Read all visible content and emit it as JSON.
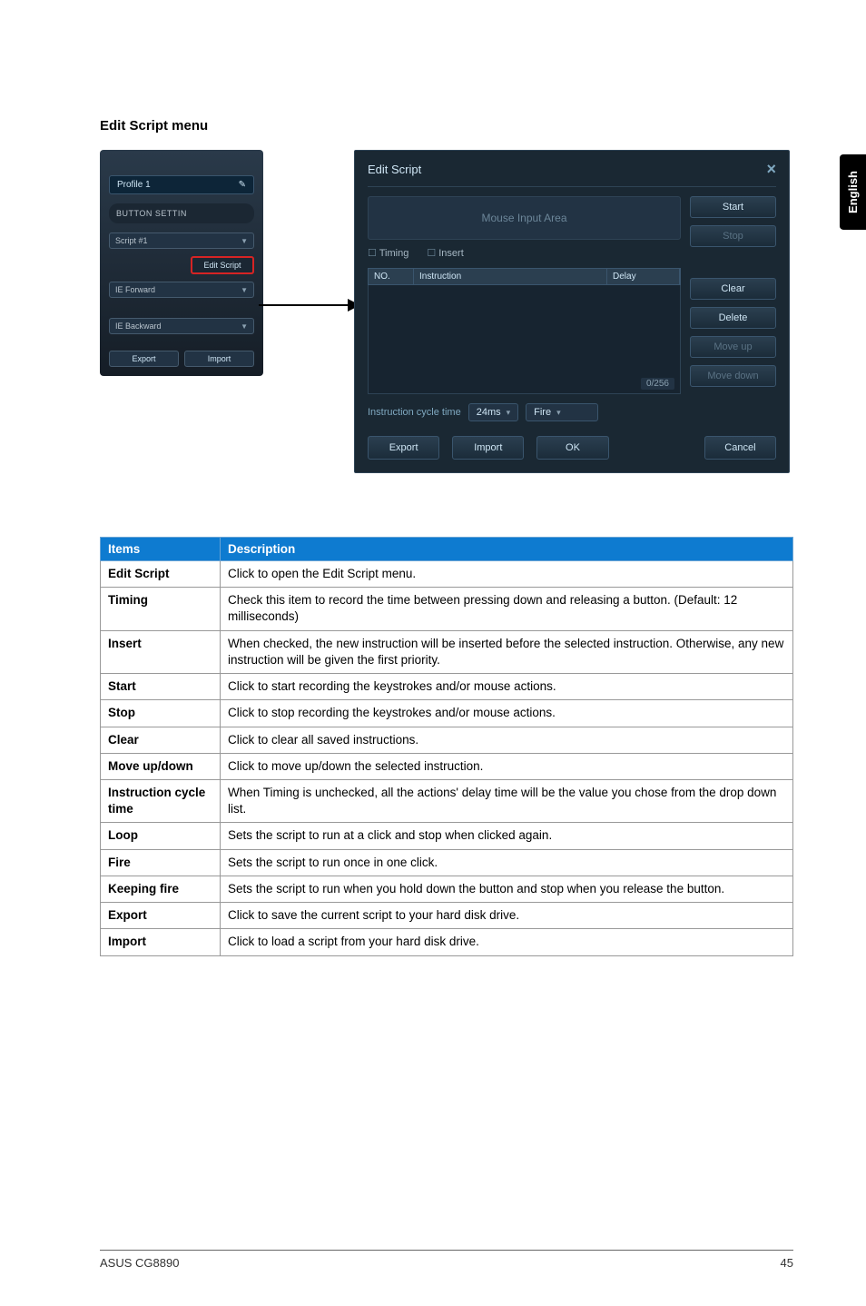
{
  "side_tab": "English",
  "section_title": "Edit Script menu",
  "left_panel": {
    "profile": "Profile 1",
    "button_settin": "BUTTON SETTIN",
    "script_dd": "Script #1",
    "edit_script_btn": "Edit Script",
    "ie_forward": "IE Forward",
    "ie_backward": "IE Backward",
    "export": "Export",
    "import": "Import"
  },
  "dialog": {
    "title": "Edit Script",
    "close": "×",
    "mouse_input": "Mouse Input Area",
    "timing": "Timing",
    "insert": "Insert",
    "col_no": "NO.",
    "col_inst": "Instruction",
    "col_delay": "Delay",
    "counter": "0/256",
    "cycle_label": "Instruction cycle time",
    "cycle_value": "24ms",
    "fire_dd": "Fire",
    "buttons": {
      "start": "Start",
      "stop": "Stop",
      "clear": "Clear",
      "delete": "Delete",
      "move_up": "Move up",
      "move_down": "Move down",
      "export": "Export",
      "import": "Import",
      "ok": "OK",
      "cancel": "Cancel"
    }
  },
  "table": {
    "headers": {
      "items": "Items",
      "desc": "Description"
    },
    "rows": [
      {
        "item": "Edit Script",
        "desc": "Click to open the Edit Script menu."
      },
      {
        "item": "Timing",
        "desc": "Check this item to record the time between pressing down and releasing a button. (Default: 12 milliseconds)"
      },
      {
        "item": "Insert",
        "desc": "When checked, the new instruction will be inserted before the selected instruction. Otherwise, any new instruction will be given the first priority."
      },
      {
        "item": "Start",
        "desc": "Click to start recording the keystrokes and/or mouse actions."
      },
      {
        "item": "Stop",
        "desc": "Click to stop recording the keystrokes and/or mouse actions."
      },
      {
        "item": "Clear",
        "desc": "Click to clear all saved instructions."
      },
      {
        "item": "Move up/down",
        "desc": "Click to move up/down the selected instruction."
      },
      {
        "item": "Instruction cycle time",
        "desc": "When Timing is unchecked, all the actions' delay time will be the value you chose from the drop down list."
      },
      {
        "item": "Loop",
        "desc": "Sets the script to run at a click and stop when clicked again."
      },
      {
        "item": "Fire",
        "desc": "Sets the script to run once in one click."
      },
      {
        "item": "Keeping fire",
        "desc": "Sets the script to run when you hold down the button and stop when you release the button."
      },
      {
        "item": "Export",
        "desc": "Click to save the current script to your hard disk drive."
      },
      {
        "item": "Import",
        "desc": "Click to load a script from your hard disk drive."
      }
    ]
  },
  "footer": {
    "left": "ASUS CG8890",
    "right": "45"
  }
}
